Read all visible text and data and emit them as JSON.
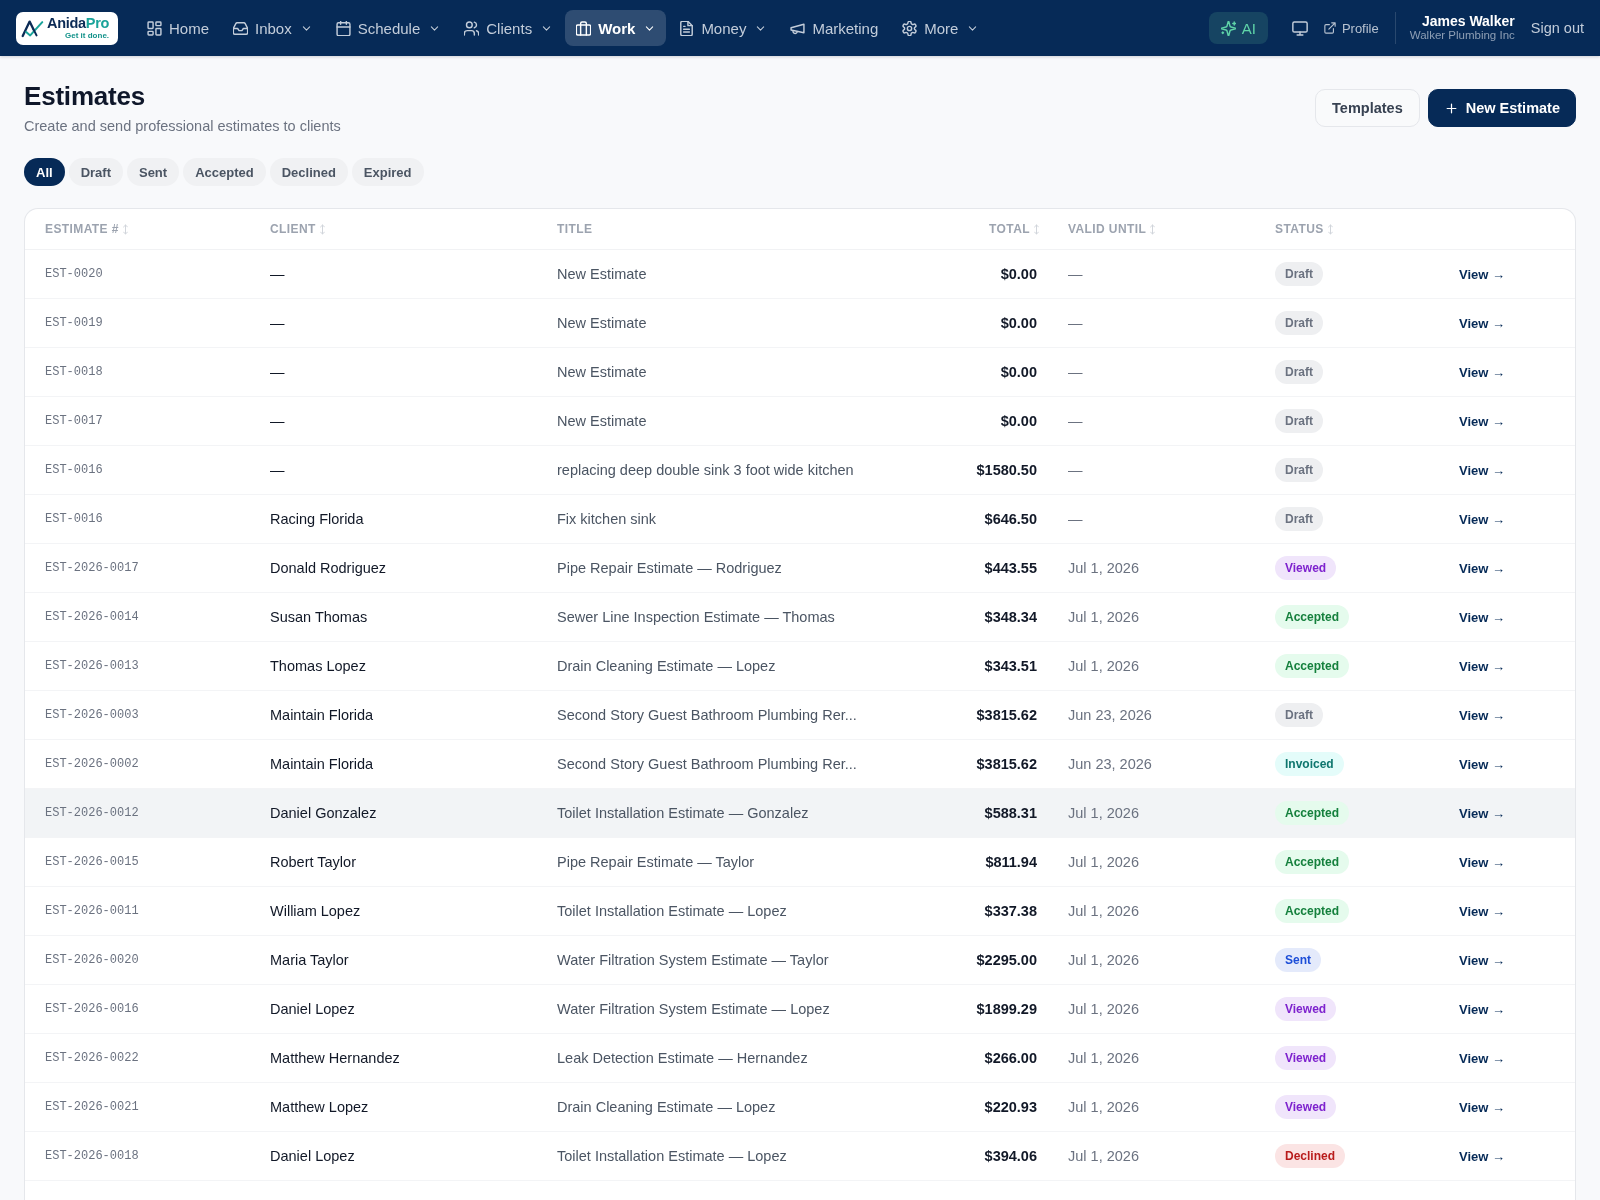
{
  "navbar": {
    "logo": {
      "name": "Anida",
      "accent": "Pro",
      "tagline": "Get it done."
    },
    "items": [
      {
        "label": "Home",
        "dropdown": false,
        "selected": false
      },
      {
        "label": "Inbox",
        "dropdown": true,
        "selected": false
      },
      {
        "label": "Schedule",
        "dropdown": true,
        "selected": false
      },
      {
        "label": "Clients",
        "dropdown": true,
        "selected": false
      },
      {
        "label": "Work",
        "dropdown": true,
        "selected": true
      },
      {
        "label": "Money",
        "dropdown": true,
        "selected": false
      },
      {
        "label": "Marketing",
        "dropdown": false,
        "selected": false
      },
      {
        "label": "More",
        "dropdown": true,
        "selected": false
      }
    ],
    "ai_button": {
      "label": "AI"
    },
    "profile_link": {
      "label": "Profile"
    },
    "user": {
      "name": "James Walker",
      "company": "Walker Plumbing Inc"
    },
    "sign_out": {
      "label": "Sign out"
    }
  },
  "header": {
    "title": "Estimates",
    "subtitle": "Create and send professional estimates to clients",
    "buttons": [
      {
        "label": "Templates",
        "kind": "secondary"
      },
      {
        "label": "New Estimate",
        "kind": "primary"
      }
    ]
  },
  "filters": [
    {
      "label": "All",
      "selected": true
    },
    {
      "label": "Draft",
      "selected": false
    },
    {
      "label": "Sent",
      "selected": false
    },
    {
      "label": "Accepted",
      "selected": false
    },
    {
      "label": "Declined",
      "selected": false
    },
    {
      "label": "Expired",
      "selected": false
    }
  ],
  "table": {
    "columns": [
      {
        "label": "ESTIMATE #",
        "sortable": true
      },
      {
        "label": "CLIENT",
        "sortable": true
      },
      {
        "label": "TITLE",
        "sortable": false
      },
      {
        "label": "TOTAL",
        "sortable": true
      },
      {
        "label": "VALID UNTIL",
        "sortable": true
      },
      {
        "label": "STATUS",
        "sortable": true
      }
    ],
    "rows": [
      {
        "number": "EST-0020",
        "client": "—",
        "title": "New Estimate",
        "total": "$0.00",
        "valid_until": "—",
        "status": {
          "label": "Draft",
          "color": "#6b7280"
        },
        "action": "View →",
        "hovered": false
      },
      {
        "number": "EST-0019",
        "client": "—",
        "title": "New Estimate",
        "total": "$0.00",
        "valid_until": "—",
        "status": {
          "label": "Draft",
          "color": "#6b7280"
        },
        "action": "View →",
        "hovered": false
      },
      {
        "number": "EST-0018",
        "client": "—",
        "title": "New Estimate",
        "total": "$0.00",
        "valid_until": "—",
        "status": {
          "label": "Draft",
          "color": "#6b7280"
        },
        "action": "View →",
        "hovered": false
      },
      {
        "number": "EST-0017",
        "client": "—",
        "title": "New Estimate",
        "total": "$0.00",
        "valid_until": "—",
        "status": {
          "label": "Draft",
          "color": "#6b7280"
        },
        "action": "View →",
        "hovered": false
      },
      {
        "number": "EST-0016",
        "client": "—",
        "title": "replacing deep double sink 3 foot wide kitchen",
        "total": "$1580.50",
        "valid_until": "—",
        "status": {
          "label": "Draft",
          "color": "#6b7280"
        },
        "action": "View →",
        "hovered": false
      },
      {
        "number": "EST-0016",
        "client": "Racing Florida",
        "title": "Fix kitchen sink",
        "total": "$646.50",
        "valid_until": "—",
        "status": {
          "label": "Draft",
          "color": "#6b7280"
        },
        "action": "View →",
        "hovered": false
      },
      {
        "number": "EST-2026-0017",
        "client": "Donald Rodriguez",
        "title": "Pipe Repair Estimate — Rodriguez",
        "total": "$443.55",
        "valid_until": "Jul 1, 2026",
        "status": {
          "label": "Viewed",
          "color": "#7e22ce"
        },
        "action": "View →",
        "hovered": false
      },
      {
        "number": "EST-2026-0014",
        "client": "Susan Thomas",
        "title": "Sewer Line Inspection Estimate — Thomas",
        "total": "$348.34",
        "valid_until": "Jul 1, 2026",
        "status": {
          "label": "Accepted",
          "color": "#15803d"
        },
        "action": "View →",
        "hovered": false
      },
      {
        "number": "EST-2026-0013",
        "client": "Thomas Lopez",
        "title": "Drain Cleaning Estimate — Lopez",
        "total": "$343.51",
        "valid_until": "Jul 1, 2026",
        "status": {
          "label": "Accepted",
          "color": "#15803d"
        },
        "action": "View →",
        "hovered": false
      },
      {
        "number": "EST-2026-0003",
        "client": "Maintain Florida",
        "title": "Second Story Guest Bathroom Plumbing Rer...",
        "total": "$3815.62",
        "valid_until": "Jun 23, 2026",
        "status": {
          "label": "Draft",
          "color": "#6b7280"
        },
        "action": "View →",
        "hovered": false
      },
      {
        "number": "EST-2026-0002",
        "client": "Maintain Florida",
        "title": "Second Story Guest Bathroom Plumbing Rer...",
        "total": "$3815.62",
        "valid_until": "Jun 23, 2026",
        "status": {
          "label": "Invoiced",
          "color": "#0f766e"
        },
        "action": "View →",
        "hovered": false
      },
      {
        "number": "EST-2026-0012",
        "client": "Daniel Gonzalez",
        "title": "Toilet Installation Estimate — Gonzalez",
        "total": "$588.31",
        "valid_until": "Jul 1, 2026",
        "status": {
          "label": "Accepted",
          "color": "#15803d"
        },
        "action": "View →",
        "hovered": true
      },
      {
        "number": "EST-2026-0015",
        "client": "Robert Taylor",
        "title": "Pipe Repair Estimate — Taylor",
        "total": "$811.94",
        "valid_until": "Jul 1, 2026",
        "status": {
          "label": "Accepted",
          "color": "#15803d"
        },
        "action": "View →",
        "hovered": false
      },
      {
        "number": "EST-2026-0011",
        "client": "William Lopez",
        "title": "Toilet Installation Estimate — Lopez",
        "total": "$337.38",
        "valid_until": "Jul 1, 2026",
        "status": {
          "label": "Accepted",
          "color": "#15803d"
        },
        "action": "View →",
        "hovered": false
      },
      {
        "number": "EST-2026-0020",
        "client": "Maria Taylor",
        "title": "Water Filtration System Estimate — Taylor",
        "total": "$2295.00",
        "valid_until": "Jul 1, 2026",
        "status": {
          "label": "Sent",
          "color": "#1d4ed8"
        },
        "action": "View →",
        "hovered": false
      },
      {
        "number": "EST-2026-0016",
        "client": "Daniel Lopez",
        "title": "Water Filtration System Estimate — Lopez",
        "total": "$1899.29",
        "valid_until": "Jul 1, 2026",
        "status": {
          "label": "Viewed",
          "color": "#7e22ce"
        },
        "action": "View →",
        "hovered": false
      },
      {
        "number": "EST-2026-0022",
        "client": "Matthew Hernandez",
        "title": "Leak Detection Estimate — Hernandez",
        "total": "$266.00",
        "valid_until": "Jul 1, 2026",
        "status": {
          "label": "Viewed",
          "color": "#7e22ce"
        },
        "action": "View →",
        "hovered": false
      },
      {
        "number": "EST-2026-0021",
        "client": "Matthew Lopez",
        "title": "Drain Cleaning Estimate — Lopez",
        "total": "$220.93",
        "valid_until": "Jul 1, 2026",
        "status": {
          "label": "Viewed",
          "color": "#7e22ce"
        },
        "action": "View →",
        "hovered": false
      },
      {
        "number": "EST-2026-0018",
        "client": "Daniel Lopez",
        "title": "Toilet Installation Estimate — Lopez",
        "total": "$394.06",
        "valid_until": "Jul 1, 2026",
        "status": {
          "label": "Declined",
          "color": "#b91c1c"
        },
        "action": "View →",
        "hovered": false
      }
    ]
  }
}
